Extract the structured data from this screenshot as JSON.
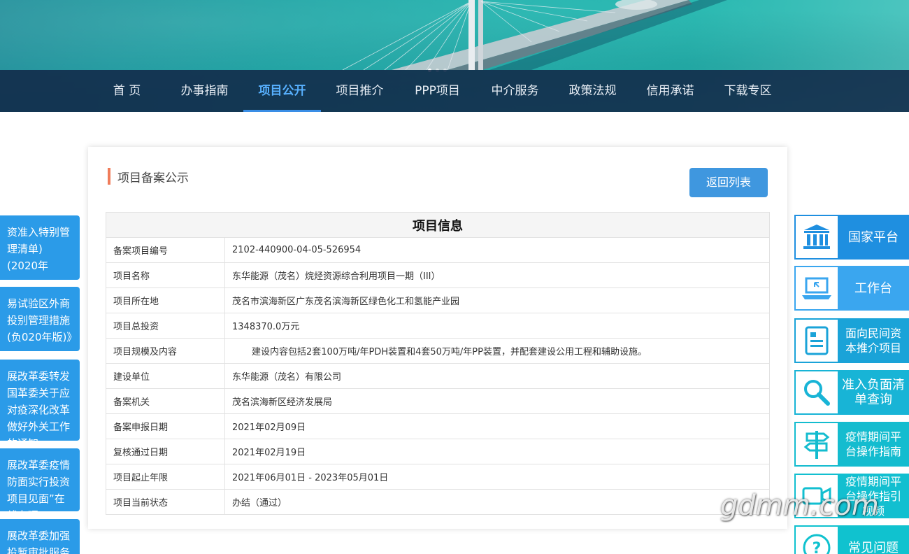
{
  "nav": {
    "items": [
      "首 页",
      "办事指南",
      "项目公开",
      "项目推介",
      "PPP项目",
      "中介服务",
      "政策法规",
      "信用承诺",
      "下载专区"
    ],
    "active_index": 2
  },
  "left_news": [
    "资准入特别管理清单)(2020年",
    "易试验区外商投别管理措施(负020年版)》",
    "展改革委转发国革委关于应对疫深化改革做好外关工作的通知",
    "展改革委疫情防面实行投资项目见面”在线办理",
    "展改革委加强投暂审批服务保障"
  ],
  "card": {
    "title": "项目备案公示",
    "back_button": "返回列表",
    "table_title": "项目信息",
    "rows": [
      {
        "key": "备案项目编号",
        "value": "2102-440900-04-05-526954"
      },
      {
        "key": "项目名称",
        "value": "东华能源（茂名）烷烃资源综合利用项目一期（III）"
      },
      {
        "key": "项目所在地",
        "value": "茂名市滨海新区广东茂名滨海新区绿色化工和氢能产业园"
      },
      {
        "key": "项目总投资",
        "value": "1348370.0万元"
      },
      {
        "key": "项目规模及内容",
        "value": "建设内容包括2套100万吨/年PDH装置和4套50万吨/年PP装置，并配套建设公用工程和辅助设施。"
      },
      {
        "key": "建设单位",
        "value": "东华能源（茂名）有限公司"
      },
      {
        "key": "备案机关",
        "value": "茂名滨海新区经济发展局"
      },
      {
        "key": "备案申报日期",
        "value": "2021年02月09日"
      },
      {
        "key": "复核通过日期",
        "value": "2021年02月19日"
      },
      {
        "key": "项目起止年限",
        "value": "2021年06月01日 - 2023年05月01日"
      },
      {
        "key": "项目当前状态",
        "value": "办结（通过）"
      }
    ]
  },
  "quick_links": [
    {
      "label": "国家平台",
      "icon": "government-building-icon"
    },
    {
      "label": "工作台",
      "icon": "laptop-icon"
    },
    {
      "label": "面向民间资本推介项目",
      "icon": "document-icon"
    },
    {
      "label": "准入负面清单查询",
      "icon": "search-icon"
    },
    {
      "label": "疫情期间平台操作指南",
      "icon": "signpost-icon"
    },
    {
      "label": "疫情期间平台操作指引视频",
      "icon": "video-camera-icon"
    },
    {
      "label": "常见问题",
      "icon": "question-icon"
    }
  ],
  "watermark": "gdmm.com"
}
